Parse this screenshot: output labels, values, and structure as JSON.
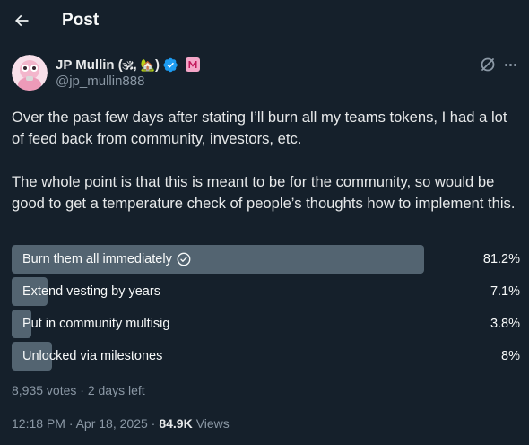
{
  "header": {
    "title": "Post",
    "back_icon": "arrow-left-icon"
  },
  "author": {
    "display_name": "JP Mullin (",
    "name_emoji_1": "🕉",
    "name_sep": ",",
    "name_emoji_2": "🏡",
    "name_close": ")",
    "handle": "@jp_mullin888",
    "verified_color": "#1d9bf0",
    "affiliate_badge_color": "#f4a6c8"
  },
  "tweet": {
    "paragraph_1": "Over the past few days after stating I’ll burn all my teams tokens, I had a lot of feed back from community, investors, etc.",
    "paragraph_2": "The whole point is that this is meant to be for the community, so would be good to get a temperature check of people’s thoughts how to implement this."
  },
  "poll": {
    "options": [
      {
        "label": "Burn them all immediately",
        "percent_label": "81.2%",
        "fraction": 0.812,
        "winner": true
      },
      {
        "label": "Extend vesting by years",
        "percent_label": "7.1%",
        "fraction": 0.071,
        "winner": false
      },
      {
        "label": "Put in community multisig",
        "percent_label": "3.8%",
        "fraction": 0.038,
        "winner": false
      },
      {
        "label": "Unlocked via milestones",
        "percent_label": "8%",
        "fraction": 0.08,
        "winner": false
      }
    ],
    "meta": "8,935 votes · 2 days left"
  },
  "footer": {
    "time": "12:18 PM · Apr 18, 2025 ·",
    "views_count": "84.9K",
    "views_label": "Views"
  },
  "colors": {
    "background": "#15202b",
    "bar": "#536471",
    "muted": "#8b98a5"
  }
}
